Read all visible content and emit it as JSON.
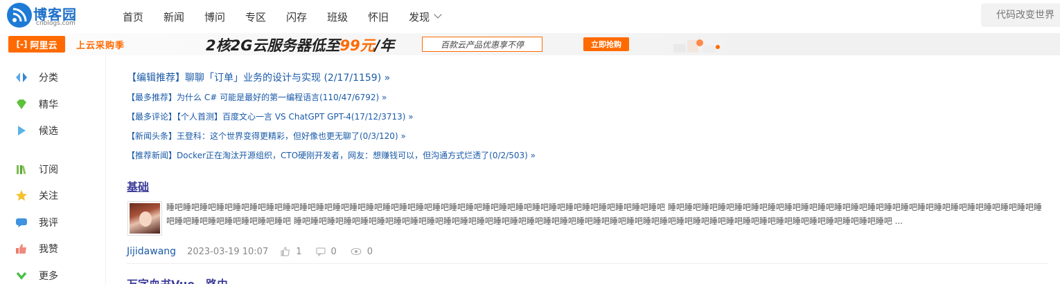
{
  "header": {
    "logo_text": "博客园",
    "logo_sub": "cnblogs.com",
    "nav": [
      "首页",
      "新闻",
      "博问",
      "专区",
      "闪存",
      "班级",
      "怀旧",
      "发现"
    ],
    "search_placeholder": "代码改变世界"
  },
  "banner": {
    "brand": "阿里云",
    "campaign": "上云采购季",
    "headline_prefix": "2核2G云服务器低至",
    "headline_price": "99元",
    "headline_suffix": "/年",
    "sub": "百款云产品优惠享不停",
    "cta": "立即抢购",
    "accent_color": "#ff6a00"
  },
  "sidebar": {
    "items": [
      {
        "label": "分类",
        "icon": "diamond-icon"
      },
      {
        "label": "精华",
        "icon": "gem-icon"
      },
      {
        "label": "候选",
        "icon": "play-icon"
      },
      {
        "label": "订阅",
        "icon": "books-icon"
      },
      {
        "label": "关注",
        "icon": "star-icon"
      },
      {
        "label": "我评",
        "icon": "comment-icon"
      },
      {
        "label": "我赞",
        "icon": "thumb-up-icon"
      },
      {
        "label": "更多",
        "icon": "chevron-down-icon"
      }
    ]
  },
  "headlines": [
    "【编辑推荐】聊聊「订单」业务的设计与实现 (2/17/1159) »",
    "【最多推荐】为什么 C# 可能是最好的第一编程语言(110/47/6792) »",
    "【最多评论】【个人首测】百度文心一言 VS ChatGPT GPT-4(17/12/3713) »",
    "【新闻头条】王登科：这个世界变得更精彩，但好像也更无聊了(0/3/120) »",
    "【推荐新闻】Docker正在淘汰开源组织，CTO硬刚开发者，网友：想赚钱可以，但沟通方式烂透了(0/2/503) »"
  ],
  "post": {
    "title": "基础",
    "summary": "睡吧睡吧睡吧睡吧睡吧睡吧睡吧睡吧睡吧睡吧睡吧睡吧睡吧睡吧睡吧睡吧睡吧睡吧睡吧睡吧睡吧睡吧睡吧睡吧睡吧睡吧睡吧睡吧睡吧睡吧 睡吧睡吧睡吧睡吧睡吧睡吧睡吧睡吧睡吧睡吧睡吧睡吧睡吧睡吧睡吧睡吧睡吧睡吧睡吧睡吧睡吧睡吧睡吧睡吧睡吧睡吧睡吧睡吧睡吧睡吧 睡吧睡吧睡吧睡吧睡吧睡吧睡吧睡吧睡吧睡吧睡吧睡吧睡吧睡吧睡吧睡吧睡吧睡吧睡吧睡吧睡吧睡吧睡吧睡吧睡吧睡吧睡吧睡吧睡吧睡吧睡吧睡吧睡吧睡吧睡吧睡吧 ...",
    "author": "Jijidawang",
    "date": "2023-03-19 10:07",
    "likes": "1",
    "comments": "0",
    "views": "0"
  },
  "next_post": {
    "title": "万字血书Vue—路由"
  }
}
